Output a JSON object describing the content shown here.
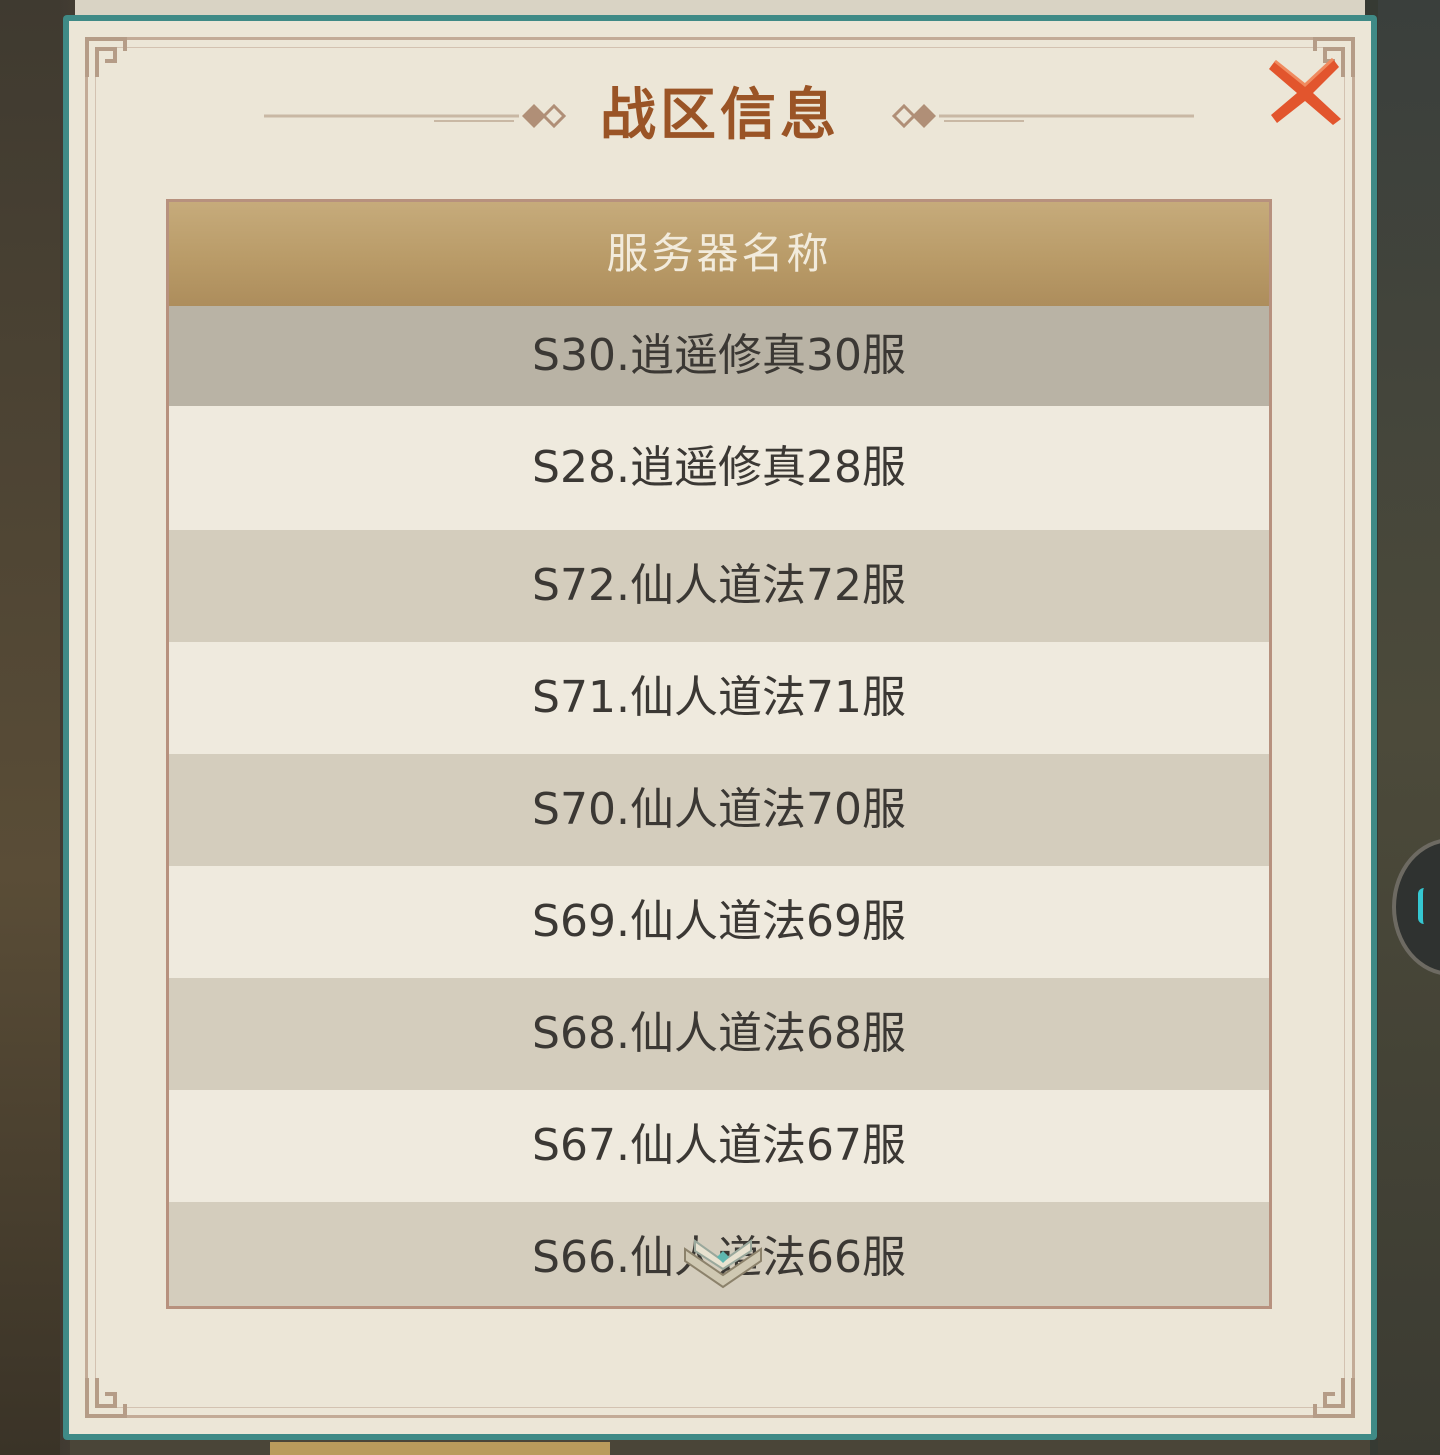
{
  "dialog": {
    "title": "战区信息",
    "close_icon": "close-x-icon",
    "accent_color": "#9a5426",
    "frame_color": "#3f8a86"
  },
  "table": {
    "header": "服务器名称",
    "rows": [
      {
        "label": "S30.逍遥修真30服",
        "selected": true
      },
      {
        "label": "S28.逍遥修真28服"
      },
      {
        "label": "S72.仙人道法72服"
      },
      {
        "label": "S71.仙人道法71服"
      },
      {
        "label": "S70.仙人道法70服"
      },
      {
        "label": "S69.仙人道法69服"
      },
      {
        "label": "S68.仙人道法68服"
      },
      {
        "label": "S67.仙人道法67服"
      },
      {
        "label": "S66.仙人道法66服"
      }
    ],
    "scroll_icon": "chevron-down-icon"
  }
}
